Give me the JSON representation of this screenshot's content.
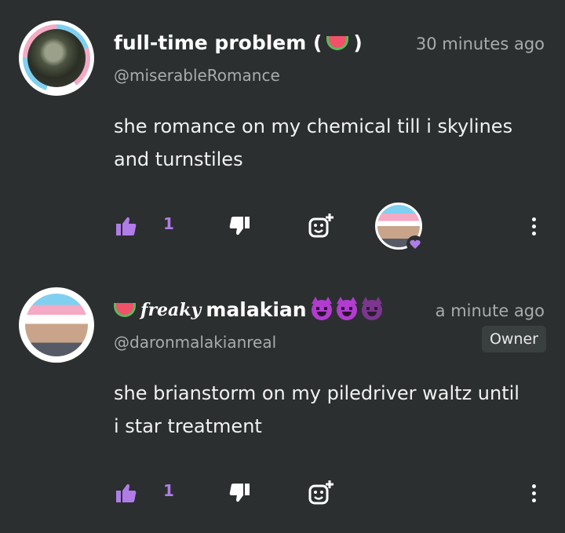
{
  "colors": {
    "background": "#2b2f2f",
    "accent": "#b07ce8",
    "muted": "#a8acac"
  },
  "comments": [
    {
      "display_name": "full-time problem (",
      "display_name_end": ")",
      "name_emoji": "watermelon-icon",
      "time": "30 minutes ago",
      "handle": "@miserableRomance",
      "text": "she romance on my chemical till i skylines and turnstiles",
      "likes": "1",
      "hearted_by_owner": true
    },
    {
      "display_name_prefix": "freaky",
      "display_name": "malakian",
      "name_emoji": "watermelon-icon",
      "trailing_emojis": [
        "smiling-imp-icon",
        "smiling-imp-icon",
        "smiling-imp-icon"
      ],
      "time": "a minute ago",
      "handle": "@daronmalakianreal",
      "badge": "Owner",
      "text": "she brianstorm on my piledriver waltz until i star treatment",
      "likes": "1"
    }
  ]
}
